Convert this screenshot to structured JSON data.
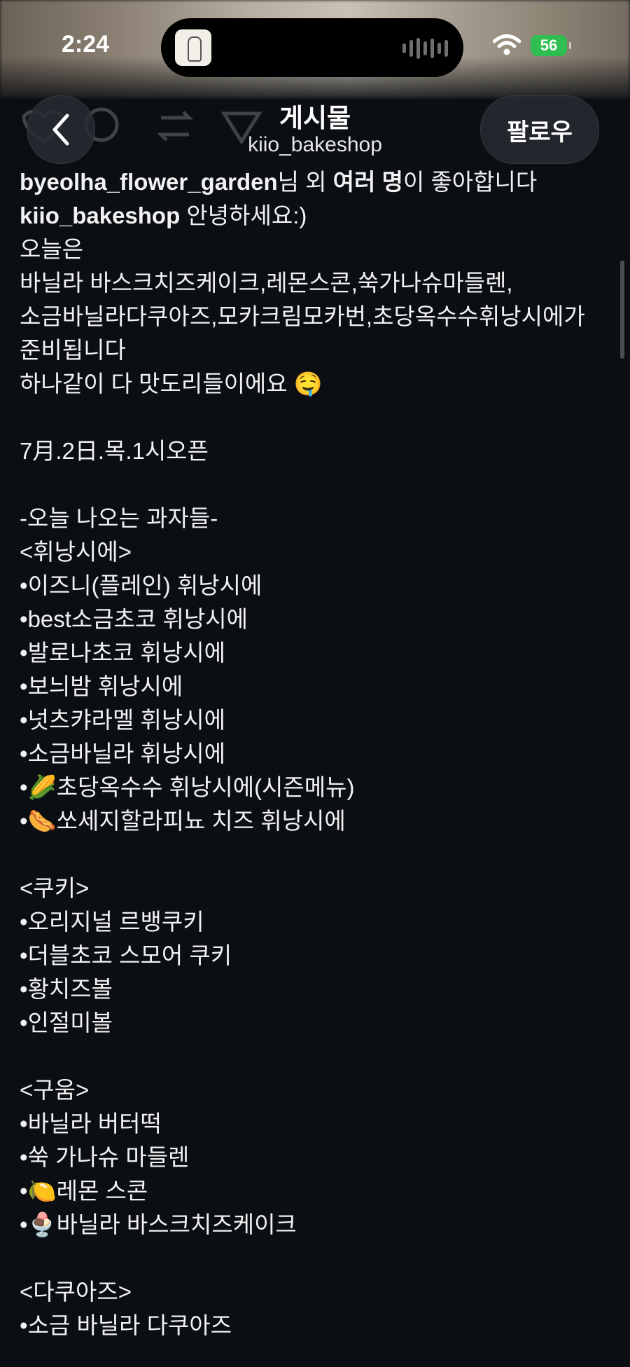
{
  "status_bar": {
    "time": "2:24",
    "battery": "56"
  },
  "header": {
    "title": "게시물",
    "username": "kiio_bakeshop",
    "follow_label": "팔로우"
  },
  "likes": {
    "user": "byeolha_flower_garden",
    "mid": "님 외 ",
    "many": "여러 명",
    "tail": "이 좋아합니다"
  },
  "caption": {
    "author": "kiio_bakeshop",
    "first": " 안녕하세요:)",
    "today": "오늘은",
    "menu_line1": "바닐라 바스크치즈케이크,레몬스콘,쑥가나슈마들렌,",
    "menu_line2": "소금바닐라다쿠아즈,모카크림모카번,초당옥수수휘낭시에가",
    "menu_line3": "준비됩니다",
    "tasty": "하나같이 다 맛도리들이에요 ",
    "tasty_emoji": "🤤",
    "open": "7月.2日.목.1시오픈",
    "section_title": "-오늘 나오는 과자들-",
    "financier_head": "<휘낭시에>",
    "financier": [
      {
        "bullet": "•",
        "emoji": "",
        "text": "이즈니(플레인) 휘낭시에"
      },
      {
        "bullet": "•",
        "emoji": "",
        "text": "best소금초코 휘낭시에"
      },
      {
        "bullet": "•",
        "emoji": "",
        "text": "발로나초코 휘낭시에"
      },
      {
        "bullet": "•",
        "emoji": "",
        "text": "보늬밤 휘낭시에"
      },
      {
        "bullet": "•",
        "emoji": "",
        "text": "넛츠캬라멜 휘낭시에"
      },
      {
        "bullet": "•",
        "emoji": "",
        "text": "소금바닐라 휘낭시에"
      },
      {
        "bullet": "•",
        "emoji": "🌽",
        "text": "초당옥수수 휘낭시에(시즌메뉴)"
      },
      {
        "bullet": "•",
        "emoji": "🌭",
        "text": "쏘세지할라피뇨 치즈 휘낭시에"
      }
    ],
    "cookie_head": "<쿠키>",
    "cookies": [
      {
        "bullet": "•",
        "emoji": "",
        "text": "오리지널 르뱅쿠키"
      },
      {
        "bullet": "•",
        "emoji": "",
        "text": "더블초코 스모어 쿠키"
      },
      {
        "bullet": "•",
        "emoji": "",
        "text": "황치즈볼"
      },
      {
        "bullet": "•",
        "emoji": "",
        "text": "인절미볼"
      }
    ],
    "baked_head": "<구움>",
    "baked": [
      {
        "bullet": "•",
        "emoji": "",
        "text": "바닐라 버터떡"
      },
      {
        "bullet": "•",
        "emoji": "",
        "text": "쑥 가나슈 마들렌"
      },
      {
        "bullet": "•",
        "emoji": "🍋",
        "text": "레몬 스콘"
      },
      {
        "bullet": "•",
        "emoji": "🍨",
        "text": "바닐라 바스크치즈케이크"
      }
    ],
    "dacq_head": "<다쿠아즈>",
    "dacq": [
      {
        "bullet": "•",
        "emoji": "",
        "text": "소금 바닐라 다쿠아즈"
      }
    ]
  }
}
